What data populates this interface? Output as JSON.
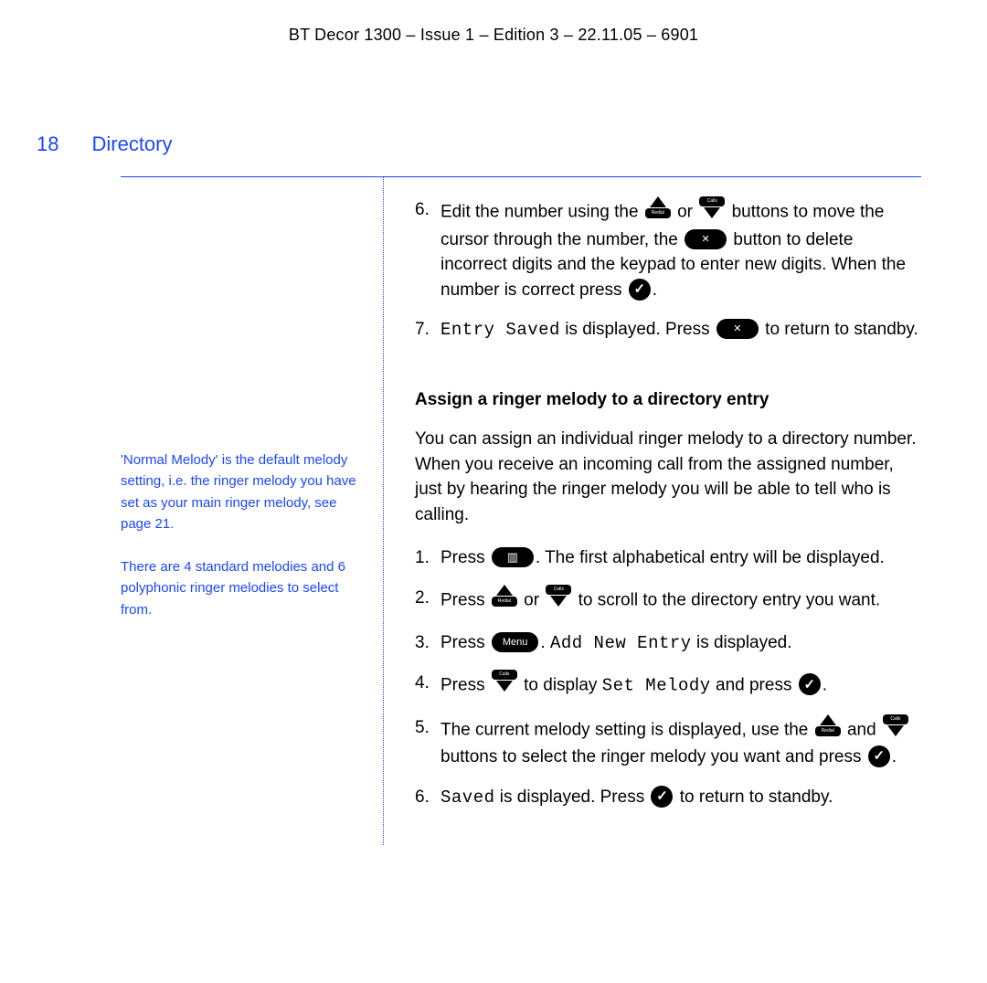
{
  "header": "BT Decor 1300 – Issue 1 – Edition 3 – 22.11.05 – 6901",
  "page_number": "18",
  "section_title": "Directory",
  "sidebar": {
    "note1": "'Normal Melody' is the default melody setting, i.e. the ringer melody you have set as your main ringer melody, see page 21.",
    "note2": "There are 4 standard melodies and 6 polyphonic ringer melodies to select from."
  },
  "icons": {
    "up_redial_label": "Redial",
    "down_calls_label": "Calls",
    "menu_label": "Menu"
  },
  "lcd": {
    "entry_saved": "Entry Saved",
    "add_new_entry": "Add New Entry",
    "set_melody": "Set Melody",
    "saved": "Saved"
  },
  "step6": {
    "n": "6.",
    "t1": "Edit the number using the ",
    "t2": " or ",
    "t3": " buttons to move the cursor through the number, the ",
    "t4": " button to delete incorrect digits and the keypad to enter new digits. When the number is correct press ",
    "t5": "."
  },
  "step7": {
    "n": "7.",
    "t1": "",
    "t2": " is displayed. Press ",
    "t3": " to return to standby."
  },
  "subhead": "Assign a ringer melody to a directory entry",
  "intro": "You can assign an individual ringer melody to a directory number. When you receive an incoming call from the assigned number, just by hearing the ringer melody you will be able to tell who is calling.",
  "m1": {
    "n": "1.",
    "t1": "Press ",
    "t2": ". The first alphabetical entry will be displayed."
  },
  "m2": {
    "n": "2.",
    "t1": "Press ",
    "t2": " or ",
    "t3": " to scroll to the directory entry you want."
  },
  "m3": {
    "n": "3.",
    "t1": "Press ",
    "t2": ". ",
    "t3": " is displayed."
  },
  "m4": {
    "n": "4.",
    "t1": "Press ",
    "t2": " to display ",
    "t3": " and press ",
    "t4": "."
  },
  "m5": {
    "n": "5.",
    "t1": "The current melody setting is displayed, use the ",
    "t2": " and ",
    "t3": " buttons to select the ringer melody you want and press ",
    "t4": "."
  },
  "m6": {
    "n": "6.",
    "t1": "",
    "t2": " is displayed. Press ",
    "t3": " to return to standby."
  }
}
